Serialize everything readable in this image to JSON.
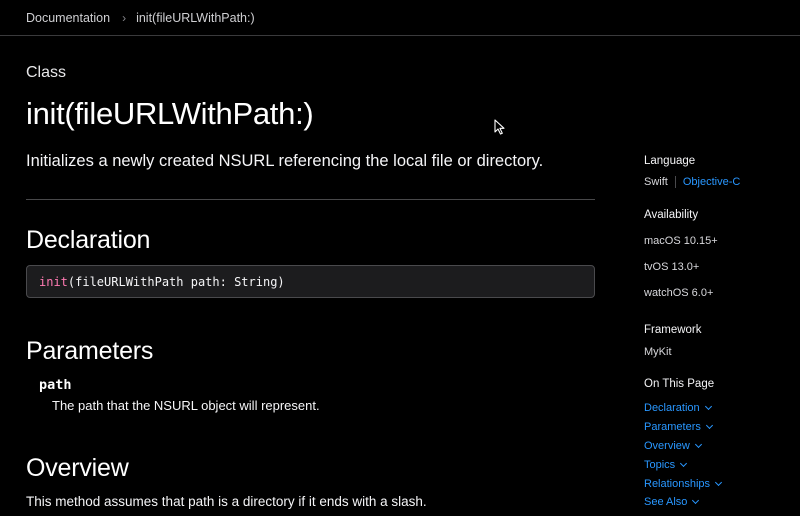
{
  "breadcrumb": {
    "root": "Documentation",
    "separator": "›",
    "current": "init(fileURLWithPath:)"
  },
  "main": {
    "eyebrow": "Class",
    "title": "init(fileURLWithPath:)",
    "abstract": "Initializes a newly created NSURL referencing the local file or directory.",
    "declaration": {
      "heading": "Declaration",
      "keyword": "init",
      "rest": "(fileURLWithPath path: String)"
    },
    "parameters": {
      "heading": "Parameters",
      "items": [
        {
          "name": "path",
          "description": "The path that the NSURL object will represent."
        }
      ]
    },
    "overview": {
      "heading": "Overview",
      "text": "This method assumes that path is a directory if it ends with a slash."
    }
  },
  "aside": {
    "language": {
      "label": "Language",
      "current": "Swift",
      "alternate": "Objective-C"
    },
    "availability": {
      "label": "Availability",
      "platforms": [
        "macOS 10.15+",
        "tvOS 13.0+",
        "watchOS 6.0+"
      ]
    },
    "framework": {
      "label": "Framework",
      "name": "MyKit"
    },
    "on_this_page": {
      "label": "On This Page",
      "items": [
        "Declaration",
        "Parameters",
        "Overview",
        "Topics",
        "Relationships",
        "See Also"
      ]
    }
  },
  "colors": {
    "background": "#000000",
    "link": "#2997ff",
    "keyword": "#ff7ab2",
    "code_background": "#1c1c1e"
  },
  "icons": {
    "breadcrumb_separator": "chevron-right-icon",
    "section_link": "chevron-down-icon",
    "pointer": "mouse-pointer-icon"
  }
}
